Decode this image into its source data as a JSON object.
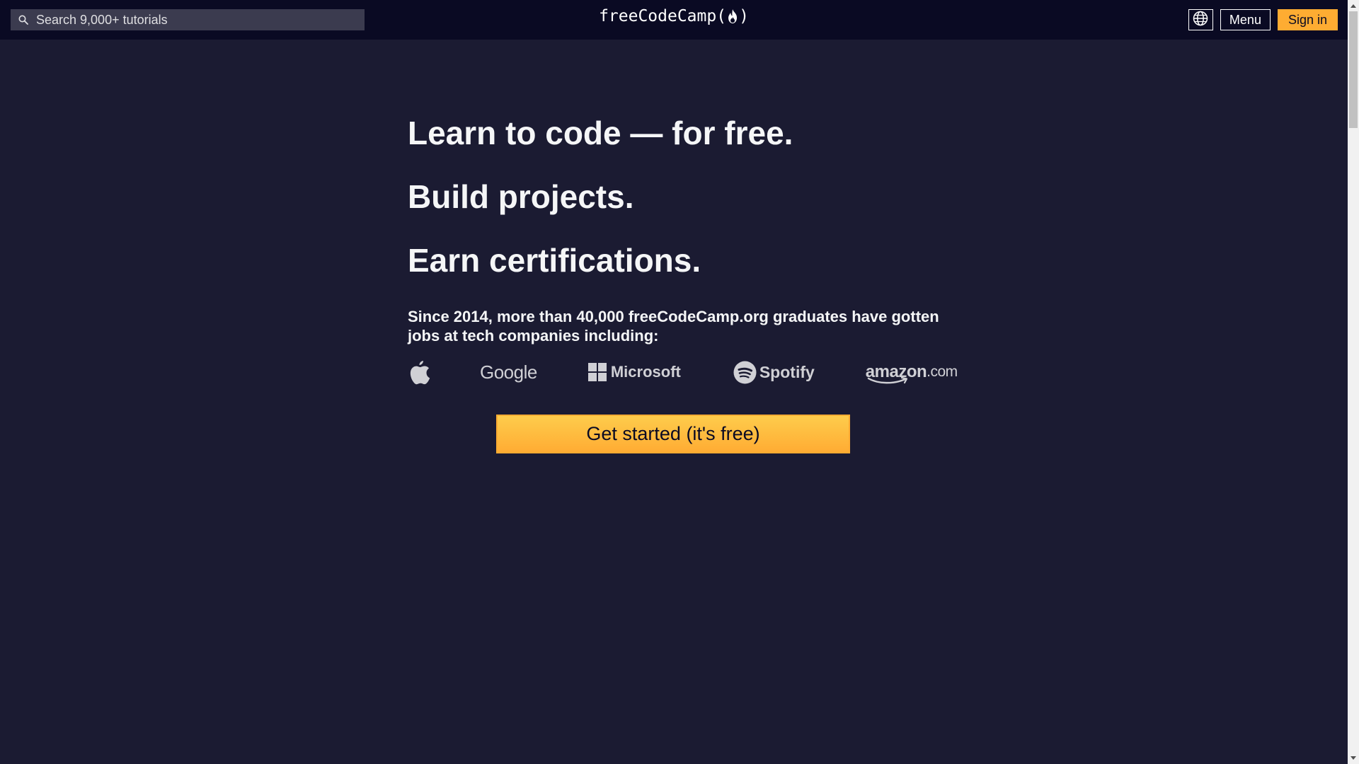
{
  "navbar": {
    "search": {
      "placeholder": "Search 9,000+ tutorials",
      "icon": "search-icon"
    },
    "logo_text_left": "freeCodeCamp(",
    "logo_text_right": ")",
    "logo_icon": "flame-icon",
    "language_icon": "globe-icon",
    "menu_label": "Menu",
    "signin_label": "Sign in"
  },
  "hero": {
    "line1": "Learn to code — for free.",
    "line2": "Build projects.",
    "line3": "Earn certifications.",
    "lead": "Since 2014, more than 40,000 freeCodeCamp.org graduates have gotten jobs at tech companies including:"
  },
  "companies": {
    "apple_icon": "apple-logo",
    "google": "Google",
    "microsoft": "Microsoft",
    "spotify": "Spotify",
    "amazon_brand": "amazon",
    "amazon_suffix": ".com"
  },
  "cta": {
    "label": "Get started (it's free)"
  },
  "colors": {
    "background": "#1b1b32",
    "navbar": "#0a0a23",
    "accent": "#feac32",
    "text": "#f5f6f7",
    "logo_gray": "#d0d0d5"
  }
}
